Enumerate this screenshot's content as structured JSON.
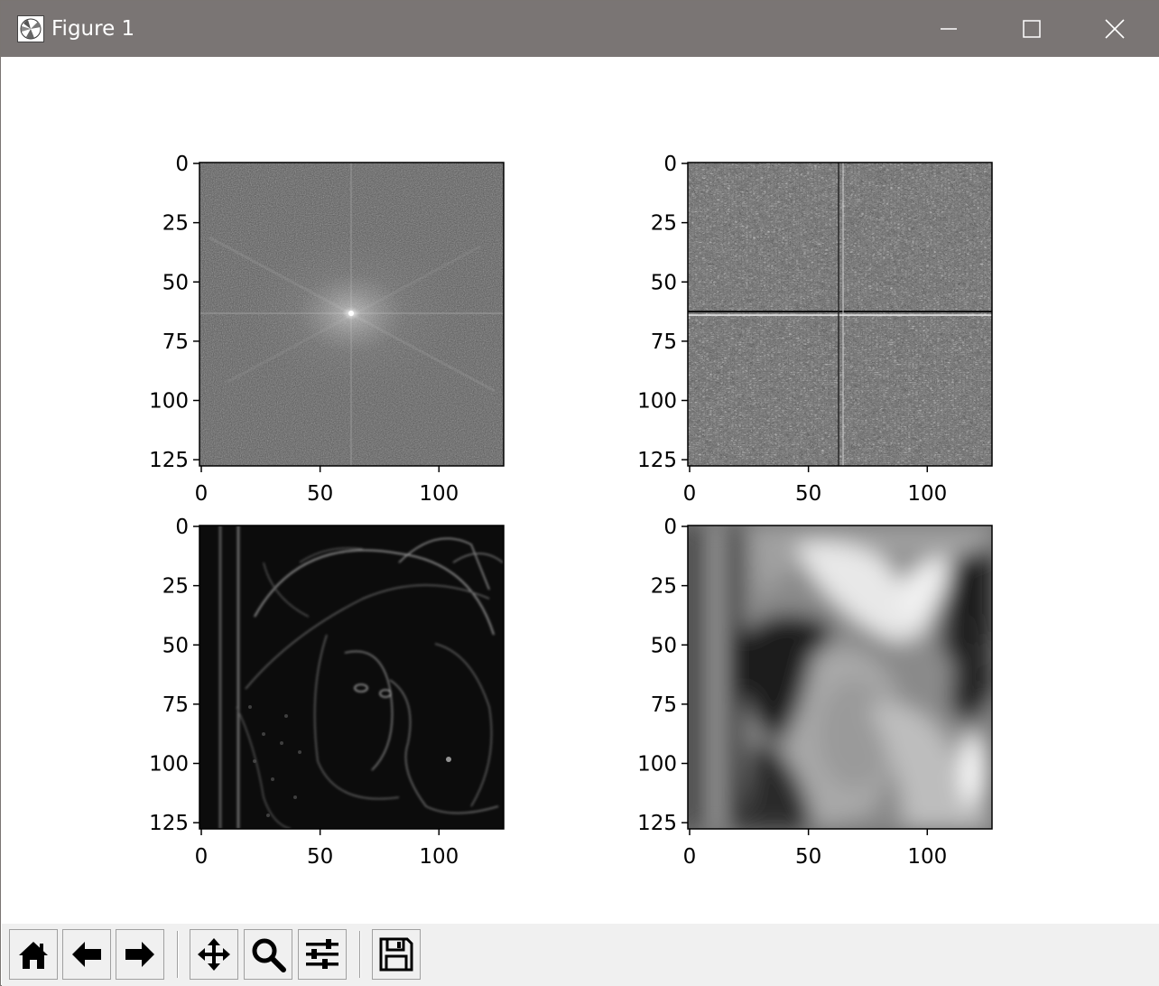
{
  "window": {
    "title": "Figure 1",
    "icon": "matplotlib-icon",
    "controls": [
      "minimize-icon",
      "maximize-icon",
      "close-icon"
    ]
  },
  "figure": {
    "subplots": [
      {
        "id": "top-left",
        "image": "Fourier magnitude spectrum (grayscale)",
        "xticks": [
          "0",
          "50",
          "100"
        ],
        "yticks": [
          "0",
          "25",
          "50",
          "75",
          "100",
          "125"
        ]
      },
      {
        "id": "top-right",
        "image": "Fourier phase spectrum (grayscale noise)",
        "xticks": [
          "0",
          "50",
          "100"
        ],
        "yticks": [
          "0",
          "25",
          "50",
          "75",
          "100",
          "125"
        ]
      },
      {
        "id": "bottom-left",
        "image": "High-pass filtered image (edges)",
        "xticks": [
          "0",
          "50",
          "100"
        ],
        "yticks": [
          "0",
          "25",
          "50",
          "75",
          "100",
          "125"
        ]
      },
      {
        "id": "bottom-right",
        "image": "Low-pass filtered image (blurred)",
        "xticks": [
          "0",
          "50",
          "100"
        ],
        "yticks": [
          "0",
          "25",
          "50",
          "75",
          "100",
          "125"
        ]
      }
    ]
  },
  "toolbar": {
    "buttons": [
      "home-icon",
      "back-icon",
      "forward-icon",
      "pan-icon",
      "zoom-icon",
      "configure-subplots-icon",
      "save-icon"
    ]
  }
}
